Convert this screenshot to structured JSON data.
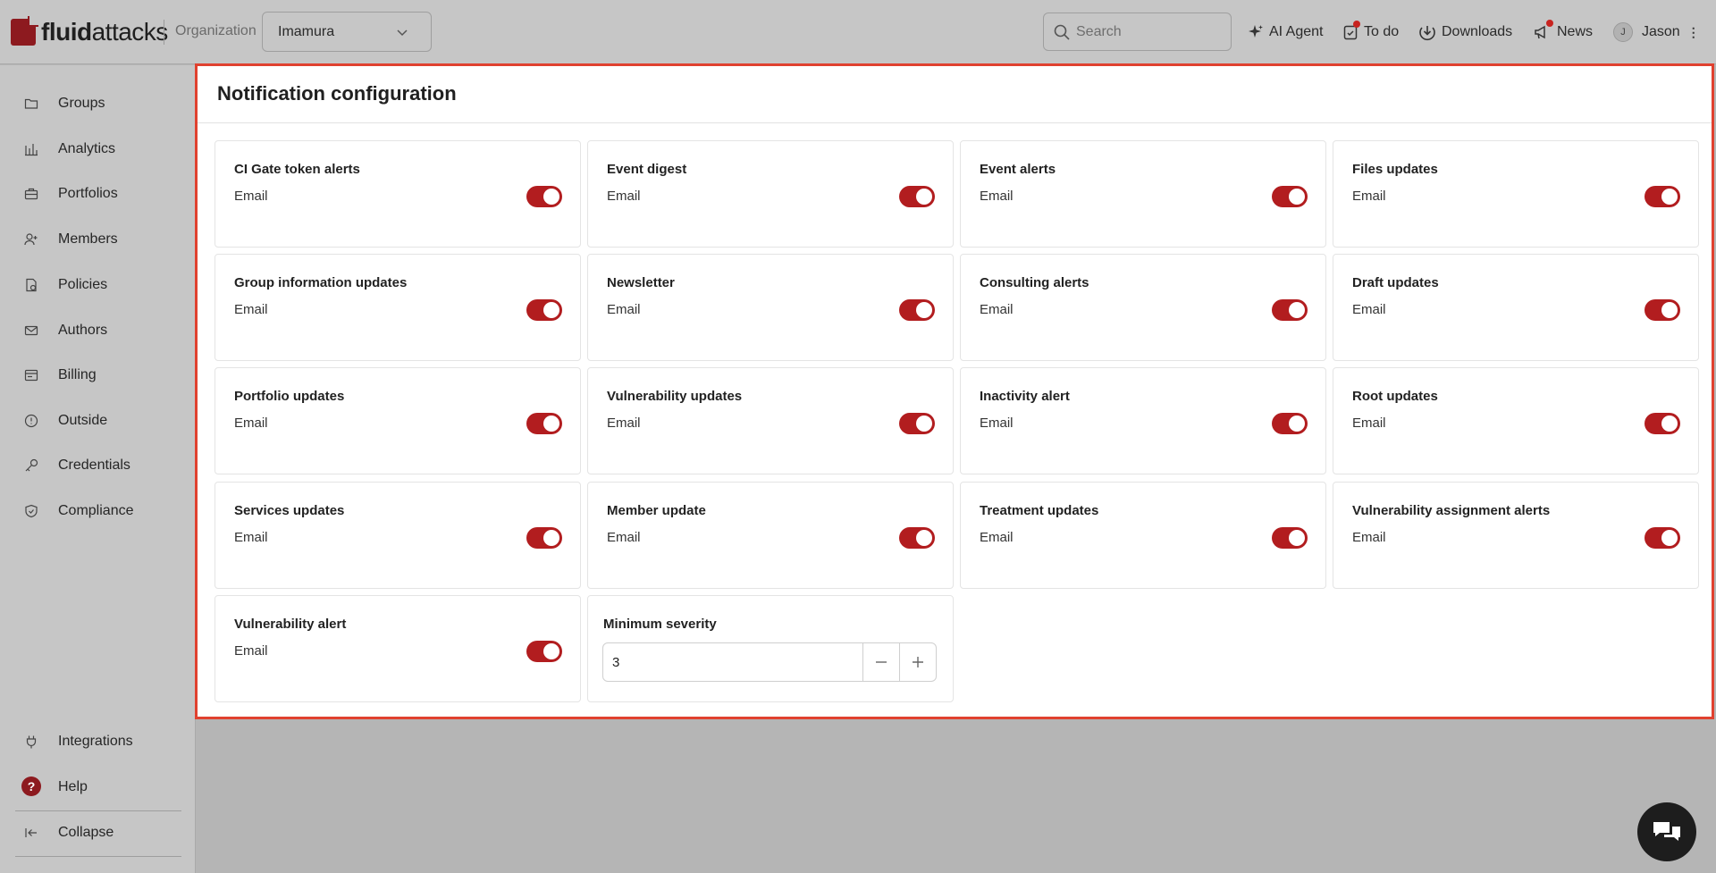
{
  "brand": {
    "prefix": "fluid",
    "suffix": "attacks"
  },
  "header": {
    "org_label": "Organization",
    "org_value": "Imamura",
    "search_placeholder": "Search",
    "actions": {
      "ai_agent": "AI Agent",
      "todo": "To do",
      "downloads": "Downloads",
      "news": "News"
    },
    "user": {
      "initial": "J",
      "name": "Jason"
    }
  },
  "sidebar": {
    "items": [
      {
        "label": "Groups",
        "icon": "folder-icon"
      },
      {
        "label": "Analytics",
        "icon": "bar-chart-icon"
      },
      {
        "label": "Portfolios",
        "icon": "briefcase-icon"
      },
      {
        "label": "Members",
        "icon": "user-plus-icon"
      },
      {
        "label": "Policies",
        "icon": "policy-icon"
      },
      {
        "label": "Authors",
        "icon": "mail-icon"
      },
      {
        "label": "Billing",
        "icon": "billing-icon"
      },
      {
        "label": "Outside",
        "icon": "outside-icon"
      },
      {
        "label": "Credentials",
        "icon": "key-icon"
      },
      {
        "label": "Compliance",
        "icon": "shield-icon"
      }
    ],
    "bottom": {
      "integrations": "Integrations",
      "help": "Help",
      "help_glyph": "?",
      "collapse": "Collapse"
    }
  },
  "panel": {
    "title": "Notification configuration",
    "cards": [
      {
        "title": "CI Gate token alerts",
        "channel": "Email",
        "enabled": true
      },
      {
        "title": "Event digest",
        "channel": "Email",
        "enabled": true
      },
      {
        "title": "Event alerts",
        "channel": "Email",
        "enabled": true
      },
      {
        "title": "Files updates",
        "channel": "Email",
        "enabled": true
      },
      {
        "title": "Group information updates",
        "channel": "Email",
        "enabled": true
      },
      {
        "title": "Newsletter",
        "channel": "Email",
        "enabled": true
      },
      {
        "title": "Consulting alerts",
        "channel": "Email",
        "enabled": true
      },
      {
        "title": "Draft updates",
        "channel": "Email",
        "enabled": true
      },
      {
        "title": "Portfolio updates",
        "channel": "Email",
        "enabled": true
      },
      {
        "title": "Vulnerability updates",
        "channel": "Email",
        "enabled": true
      },
      {
        "title": "Inactivity alert",
        "channel": "Email",
        "enabled": true
      },
      {
        "title": "Root updates",
        "channel": "Email",
        "enabled": true
      },
      {
        "title": "Services updates",
        "channel": "Email",
        "enabled": true
      },
      {
        "title": "Member update",
        "channel": "Email",
        "enabled": true
      },
      {
        "title": "Treatment updates",
        "channel": "Email",
        "enabled": true
      },
      {
        "title": "Vulnerability assignment alerts",
        "channel": "Email",
        "enabled": true
      },
      {
        "title": "Vulnerability alert",
        "channel": "Email",
        "enabled": true
      }
    ],
    "severity": {
      "label": "Minimum severity",
      "value": "3"
    }
  },
  "colors": {
    "accent": "#b21d1f",
    "highlight_border": "#e0412f",
    "brand": "#8d1a1f"
  }
}
